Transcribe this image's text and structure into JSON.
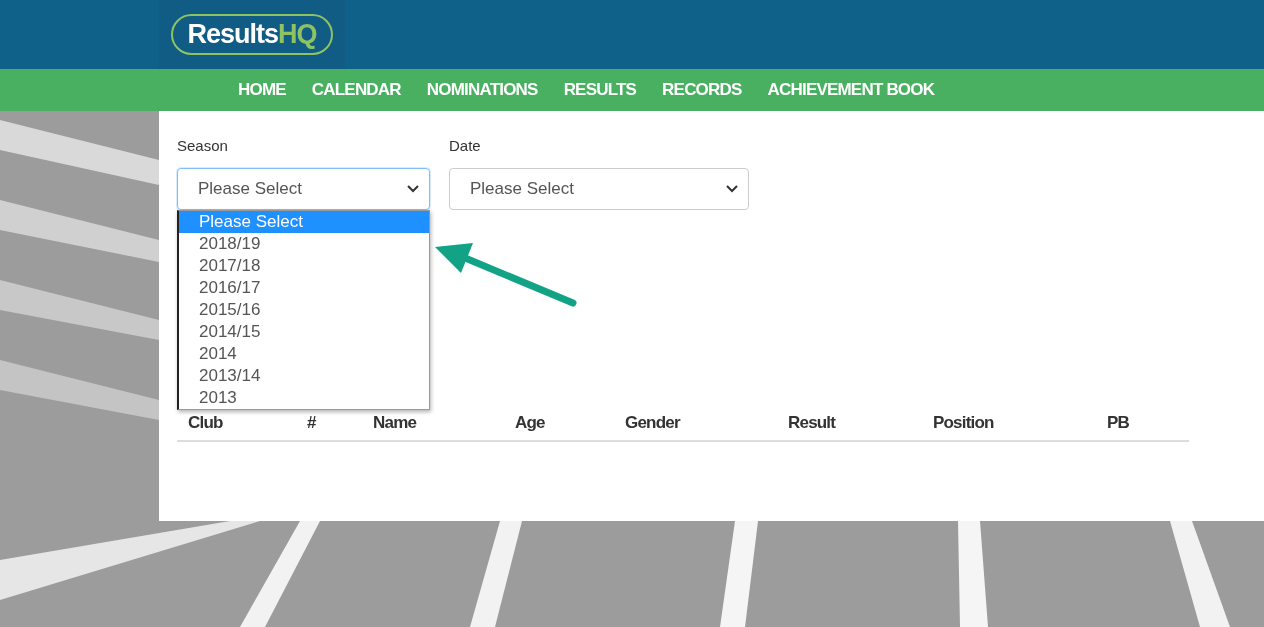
{
  "logo": {
    "text": "Results",
    "accent": "HQ"
  },
  "nav": [
    {
      "label": "HOME"
    },
    {
      "label": "CALENDAR"
    },
    {
      "label": "NOMINATIONS"
    },
    {
      "label": "RESULTS"
    },
    {
      "label": "RECORDS"
    },
    {
      "label": "ACHIEVEMENT BOOK"
    }
  ],
  "filters": [
    {
      "label": "Season",
      "value": "Please Select",
      "open": true,
      "options": [
        {
          "label": "Please Select",
          "selected": true
        },
        {
          "label": "2018/19",
          "selected": false
        },
        {
          "label": "2017/18",
          "selected": false
        },
        {
          "label": "2016/17",
          "selected": false
        },
        {
          "label": "2015/16",
          "selected": false
        },
        {
          "label": "2014/15",
          "selected": false
        },
        {
          "label": "2014",
          "selected": false
        },
        {
          "label": "2013/14",
          "selected": false
        },
        {
          "label": "2013",
          "selected": false
        }
      ]
    },
    {
      "label": "Date",
      "value": "Please Select",
      "open": false
    }
  ],
  "table": {
    "columns": [
      "Club",
      "#",
      "Name",
      "Age",
      "Gender",
      "Result",
      "Position",
      "PB"
    ]
  }
}
